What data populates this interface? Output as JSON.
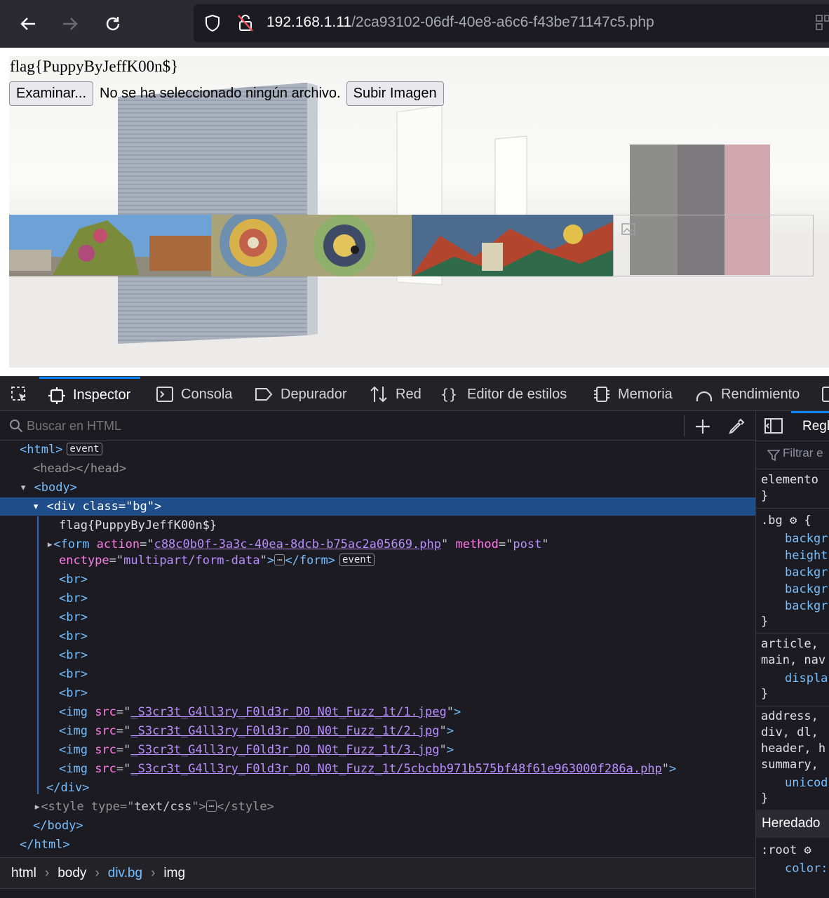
{
  "browser": {
    "url_host": "192.168.1.11",
    "url_path": "/2ca93102-06df-40e8-a6c6-f43be71147c5.php"
  },
  "page": {
    "flag": "flag{PuppyByJeffK00n$}",
    "browse_button": "Examinar...",
    "no_file_text": "No se ha seleccionado ningún archivo.",
    "upload_button": "Subir Imagen"
  },
  "devtools": {
    "tabs": [
      "Inspector",
      "Consola",
      "Depurador",
      "Red",
      "Editor de estilos",
      "Memoria",
      "Rendimiento"
    ],
    "search_placeholder": "Buscar en HTML",
    "event_badge": "event",
    "markup": {
      "html_open": "<html>",
      "head": "<head></head>",
      "body_open": "<body>",
      "div_bg": "<div class=\"bg\">",
      "flag_text": "flag{PuppyByJeffK00n$}",
      "form_action": "c88c0b0f-3a3c-40ea-8dcb-b75ac2a05669.php",
      "form_method": "post",
      "form_enctype": "multipart/form-data",
      "br": "<br>",
      "img_srcs": [
        "_S3cr3t_G4ll3ry_F0ld3r_D0_N0t_Fuzz_1t/1.jpeg",
        "_S3cr3t_G4ll3ry_F0ld3r_D0_N0t_Fuzz_1t/2.jpg",
        "_S3cr3t_G4ll3ry_F0ld3r_D0_N0t_Fuzz_1t/3.jpg",
        "_S3cr3t_G4ll3ry_F0ld3r_D0_N0t_Fuzz_1t/5cbcbb971b575bf48f61e963000f286a.php"
      ],
      "div_close": "</div>",
      "style_type": "text/css",
      "body_close": "</body>",
      "html_close": "</html>"
    },
    "breadcrumbs": [
      "html",
      "body",
      "div.bg",
      "img"
    ],
    "rules_tab": "Regl",
    "filter_placeholder": "Filtrar e",
    "rules": {
      "element": "elemento",
      "brace_close": "}",
      "bg_selector": ".bg",
      "bg_props": [
        "backgr",
        "height",
        "backgr",
        "backgr",
        "backgr"
      ],
      "article_sel_1": "article,",
      "article_sel_2": "main, nav",
      "article_prop": "displa",
      "address_sel_1": "address,",
      "address_sel_2": "div, dl,",
      "address_sel_3": "header, h",
      "address_sel_4": "summary,",
      "address_prop": "unicod",
      "inherited": "Heredado",
      "root_sel": ":root",
      "root_prop": "color:"
    }
  }
}
